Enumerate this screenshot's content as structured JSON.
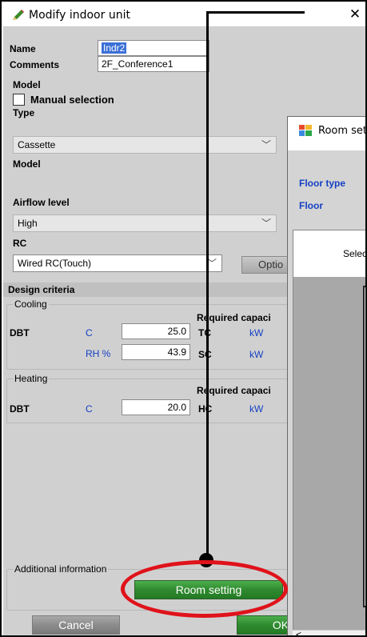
{
  "dialog": {
    "title": "Modify indoor unit",
    "close": "✕"
  },
  "form": {
    "name_label": "Name",
    "name_value": "Indr2",
    "comments_label": "Comments",
    "comments_value": "2F_Conference1",
    "model_section": "Model",
    "manual_selection": "Manual selection",
    "type_label": "Type",
    "type_value": "Cassette",
    "model_label": "Model",
    "airflow_label": "Airflow level",
    "airflow_value": "High",
    "rc_label": "RC",
    "rc_value": "Wired RC(Touch)",
    "option_button": "Optio"
  },
  "design": {
    "header": "Design criteria",
    "cooling": {
      "group": "Cooling",
      "required": "Required capaci",
      "dbt_label": "DBT",
      "dbt_unit": "C",
      "dbt_value": "25.0",
      "tc_label": "TC",
      "tc_unit": "kW",
      "rh_unit": "RH %",
      "rh_value": "43.9",
      "sc_label": "SC",
      "sc_unit": "kW"
    },
    "heating": {
      "group": "Heating",
      "required": "Required capaci",
      "dbt_label": "DBT",
      "dbt_unit": "C",
      "dbt_value": "20.0",
      "hc_label": "HC",
      "hc_unit": "kW"
    }
  },
  "additional": {
    "group": "Additional information",
    "room_setting_button": "Room setting"
  },
  "footer": {
    "cancel": "Cancel",
    "ok": "OK"
  },
  "room_window": {
    "title": "Room set",
    "floor_type_label": "Floor type",
    "floor_label": "Floor",
    "select_text": "Selec",
    "scroll_left": "<"
  },
  "colors": {
    "annotation_oval": "#e0121a",
    "link_blue": "#1540c4",
    "ok_green": "#2f8a2f"
  }
}
